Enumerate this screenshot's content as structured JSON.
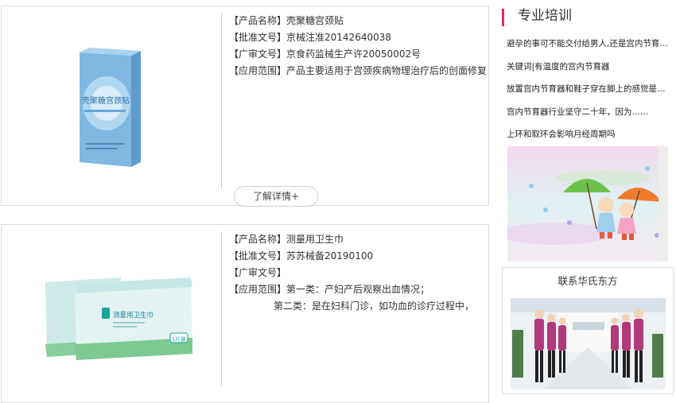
{
  "products": [
    {
      "fields": [
        {
          "label": "【产品名称】",
          "value": "壳聚糖宫颈贴"
        },
        {
          "label": "【批准文号】",
          "value": "京械注准20142640038"
        },
        {
          "label": "【广审文号】",
          "value": "京食药监械生产许20050002号"
        },
        {
          "label": "【应用范围】",
          "value": "产品主要适用于宫颈疾病物理治疗后的创面修复"
        }
      ],
      "box_text": "壳聚糖宫颈贴",
      "more_label": "了解详情+"
    },
    {
      "fields": [
        {
          "label": "【产品名称】",
          "value": "测量用卫生巾"
        },
        {
          "label": "【批准文号】",
          "value": "苏苏械备20190100"
        },
        {
          "label": "【广审文号】",
          "value": ""
        },
        {
          "label": "【应用范围】",
          "value": "第一类：产妇产后观察出血情况；"
        }
      ],
      "extra_line": "第二类：是在妇科门诊，如功血的诊疗过程中，",
      "box_text": "测量用卫生巾",
      "box_count": "1片装"
    }
  ],
  "sidebar": {
    "title": "专业培训",
    "news": [
      "避孕的事可不能交付给男人,还是宫内节育器…",
      "关键词|有温度的宫内节育器",
      "放置宫内节育器和鞋子穿在脚上的感觉是同样…",
      "宫内节育器行业坚守二十年，因为……",
      "上环和取环会影响月经周期吗"
    ],
    "contact_title": "联系华氏东方"
  },
  "colors": {
    "accent": "#e0286c",
    "border": "#dcdcdc"
  }
}
